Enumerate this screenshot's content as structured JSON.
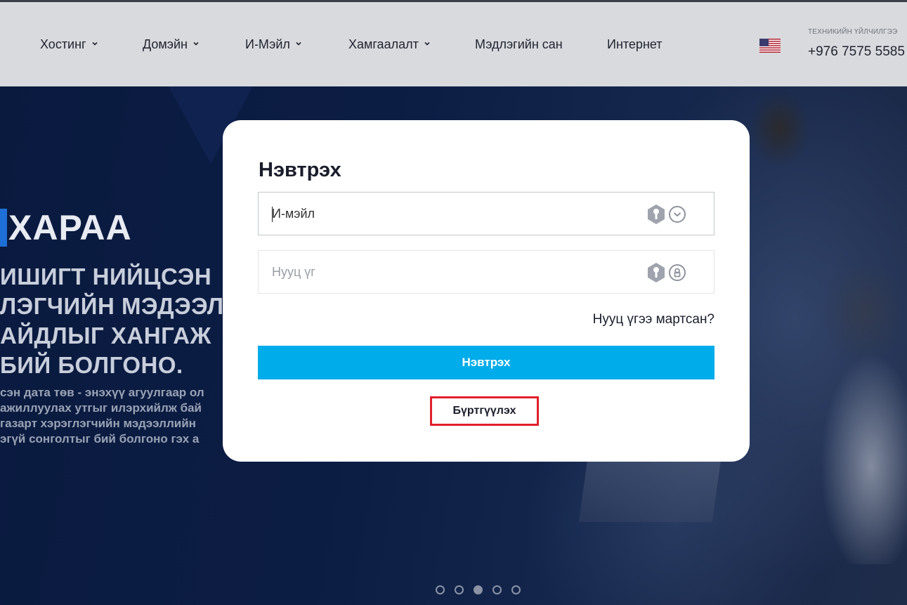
{
  "header": {
    "nav": [
      {
        "label": "Хостинг",
        "dropdown": true
      },
      {
        "label": "Домэйн",
        "dropdown": true
      },
      {
        "label": "И-Мэйл",
        "dropdown": true
      },
      {
        "label": "Хамгаалалт",
        "dropdown": true
      },
      {
        "label": "Мэдлэгийн сан",
        "dropdown": false
      },
      {
        "label": "Интернет",
        "dropdown": false
      }
    ],
    "language_flag": "us-flag-icon",
    "support_label": "ТЕХНИКИЙН ҮЙЛЧИЛГЭЭ",
    "support_phone": "+976 7575 5585"
  },
  "hero": {
    "title": "ХАРАА",
    "lines": [
      "ИШИГТ НИЙЦСЭН",
      "ЛЭГЧИЙН МЭДЭЭЛ",
      "АЙДЛЫГ ХАНГАЖ",
      "БИЙ БОЛГОНО."
    ],
    "description": [
      "сэн дата төв - энэхүү агуулгаар ол",
      "ажиллуулах утгыг илэрхийлж бай",
      "газарт хэрэглэгчийн мэдээллийн",
      "эгүй сонголтыг бий болгоно гэх а"
    ],
    "slides_count": 5,
    "active_slide": 3
  },
  "login": {
    "title": "Нэвтрэх",
    "email_placeholder": "И-мэйл",
    "password_placeholder": "Нууц үг",
    "forgot_label": "Нууц үгээ мартсан?",
    "submit_label": "Нэвтрэх",
    "register_label": "Бүртгүүлэх"
  },
  "colors": {
    "accent": "#00acea",
    "highlight": "#e0202b",
    "header_bg": "#d8dadd",
    "hero_bg": "#0b1a3a"
  }
}
